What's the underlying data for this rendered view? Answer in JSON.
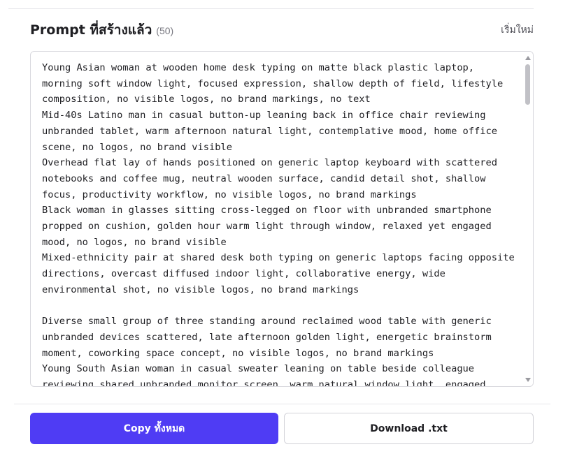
{
  "header": {
    "title": "Prompt ที่สร้างแล้ว",
    "count": "(50)",
    "reset_label": "เริ่มใหม่"
  },
  "prompts_text": "Young Asian woman at wooden home desk typing on matte black plastic laptop, morning soft window light, focused expression, shallow depth of field, lifestyle composition, no visible logos, no brand markings, no text\nMid-40s Latino man in casual button-up leaning back in office chair reviewing unbranded tablet, warm afternoon natural light, contemplative mood, home office scene, no logos, no brand visible\nOverhead flat lay of hands positioned on generic laptop keyboard with scattered notebooks and coffee mug, neutral wooden surface, candid detail shot, shallow focus, productivity workflow, no visible logos, no brand markings\nBlack woman in glasses sitting cross-legged on floor with unbranded smartphone propped on cushion, golden hour warm light through window, relaxed yet engaged mood, no logos, no brand visible\nMixed-ethnicity pair at shared desk both typing on generic laptops facing opposite directions, overcast diffused indoor light, collaborative energy, wide environmental shot, no visible logos, no brand markings\n\nDiverse small group of three standing around reclaimed wood table with generic unbranded devices scattered, late afternoon golden light, energetic brainstorm moment, coworking space concept, no visible logos, no brand markings\nYoung South Asian woman in casual sweater leaning on table beside colleague reviewing shared unbranded monitor screen, warm natural window light, engaged collaborative mood",
  "actions": {
    "copy_label": "Copy ทั้งหมด",
    "download_label": "Download .txt"
  },
  "colors": {
    "primary": "#4f3cf4",
    "border": "#d9d9de",
    "text": "#1f1f23",
    "muted": "#7a7a82"
  }
}
